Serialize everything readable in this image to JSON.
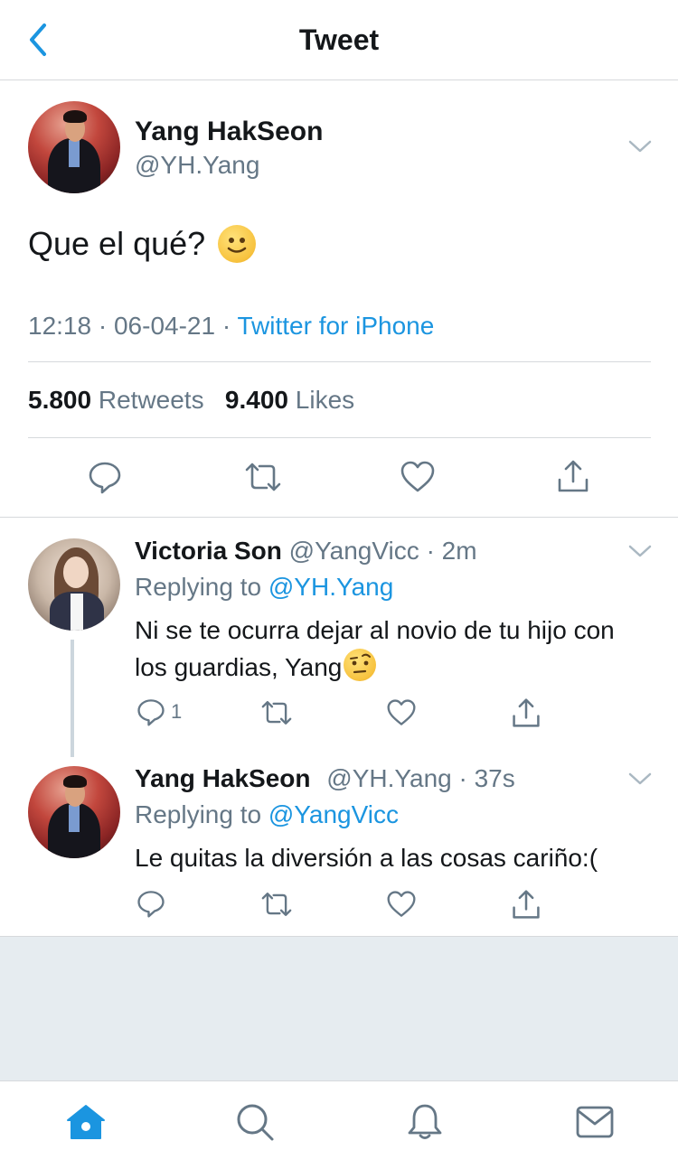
{
  "header": {
    "title": "Tweet",
    "back_icon": "chevron-left-icon"
  },
  "main_tweet": {
    "author_name": "Yang HakSeon",
    "author_handle": "@YH.Yang",
    "text": "Que el qué?",
    "emoji": "slightly-smiling-face",
    "time": "12:18",
    "date": "06-04-21",
    "source": "Twitter for iPhone",
    "retweets_count": "5.800",
    "retweets_label": "Retweets",
    "likes_count": "9.400",
    "likes_label": "Likes"
  },
  "replies": [
    {
      "author_name": "Victoria Son",
      "author_handle": "@YangVicc",
      "time": "2m",
      "replying_label": "Replying to",
      "replying_to": "@YH.Yang",
      "text": "Ni se te ocurra dejar al novio de tu hijo con los guardias, Yang",
      "emoji": "face-with-raised-eyebrow",
      "reply_count": "1"
    },
    {
      "author_name": "Yang HakSeon",
      "author_handle": "@YH.Yang",
      "time": "37s",
      "replying_label": "Replying to",
      "replying_to": "@YangVicc",
      "text": "Le quitas la diversión a las cosas cariño:(",
      "reply_count": ""
    }
  ],
  "tabs": [
    "home-icon",
    "search-icon",
    "notifications-bell-icon",
    "messages-envelope-icon"
  ],
  "colors": {
    "accent": "#1b95e0",
    "secondary_text": "#657786",
    "divider": "#d6d9dc",
    "background_gray": "#e6ecf0"
  }
}
